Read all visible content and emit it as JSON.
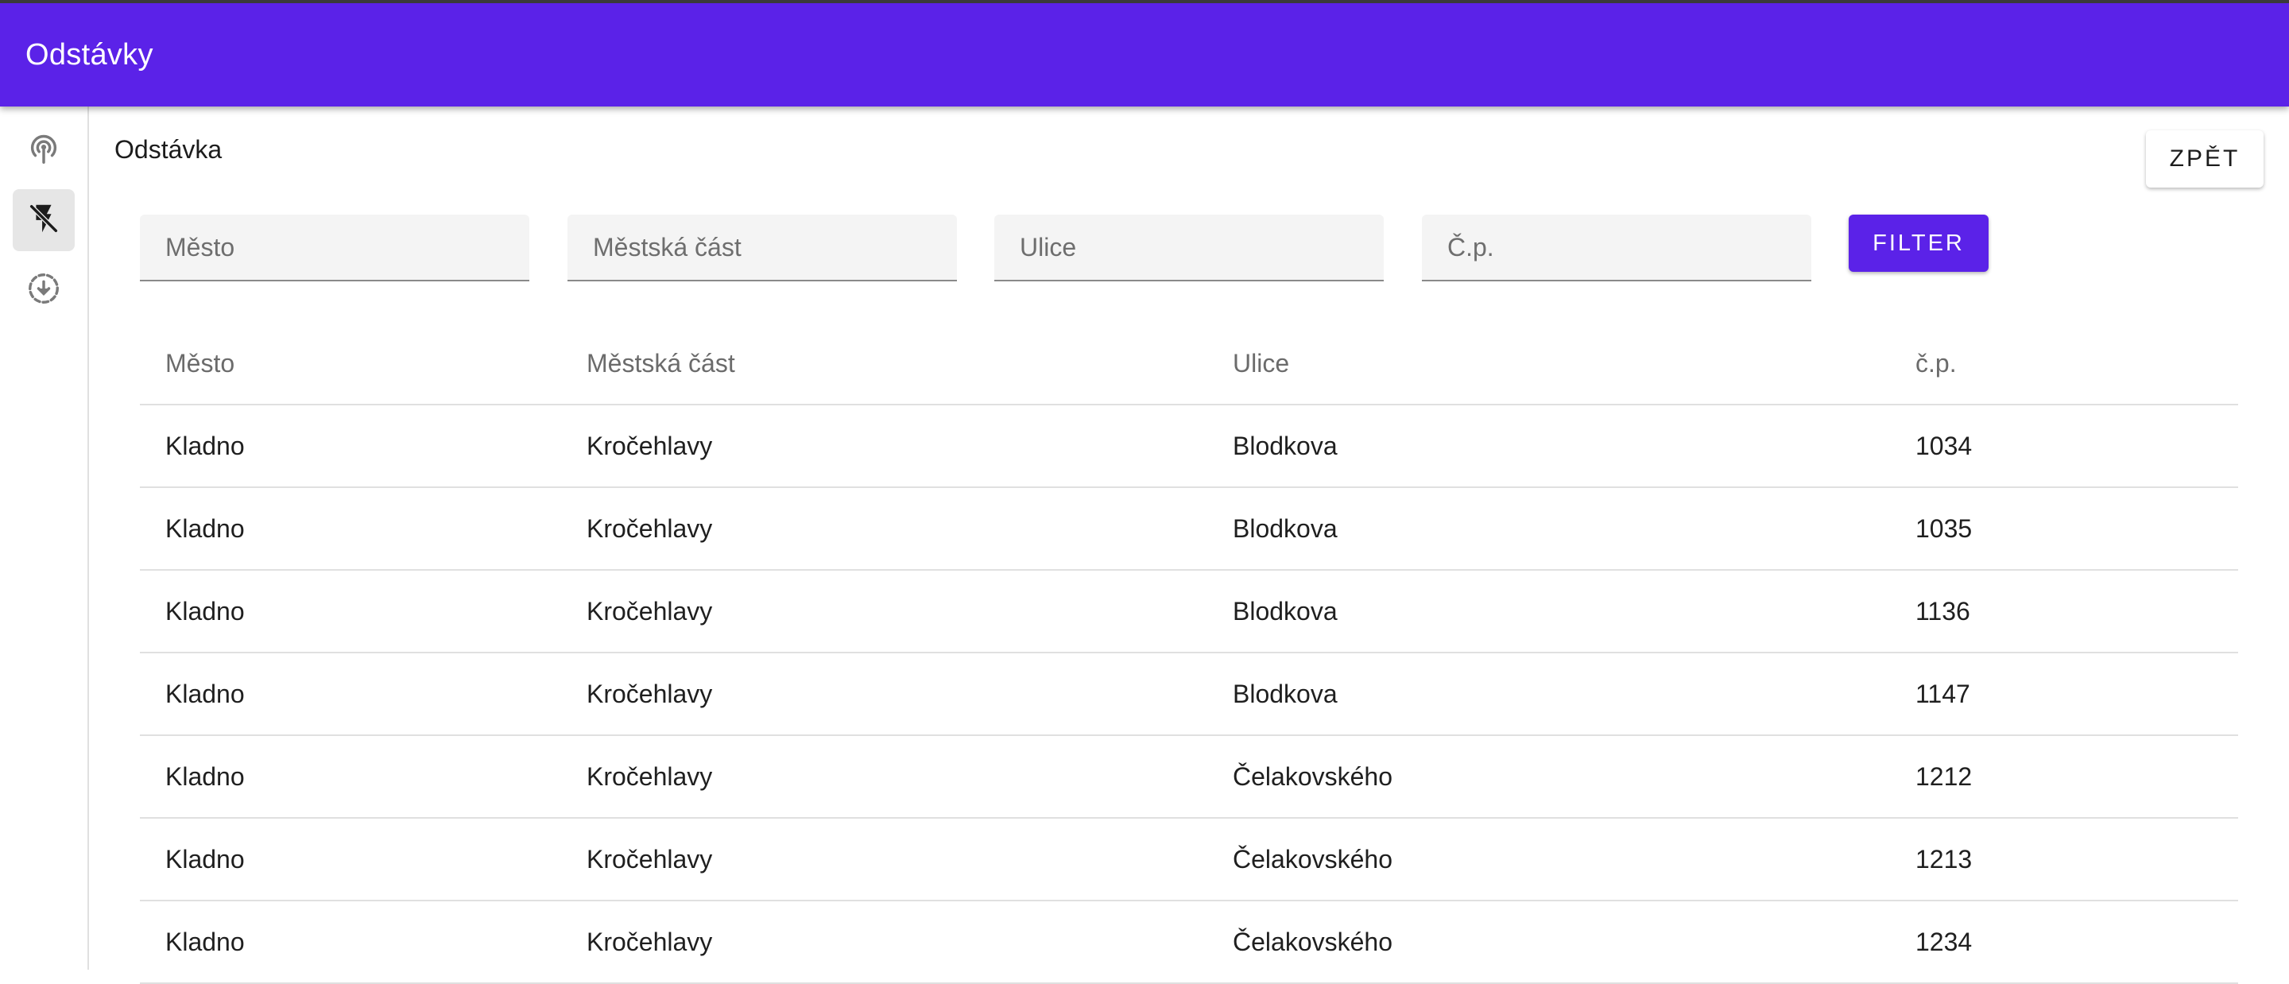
{
  "app": {
    "title": "Odstávky"
  },
  "rail": {
    "items": [
      {
        "icon": "antenna-icon",
        "active": false
      },
      {
        "icon": "flash-off-icon",
        "active": true
      },
      {
        "icon": "download-circle-icon",
        "active": false
      }
    ]
  },
  "page": {
    "section_title": "Odstávka",
    "back_label": "ZPĚT"
  },
  "filters": {
    "city_placeholder": "Město",
    "district_placeholder": "Městská část",
    "street_placeholder": "Ulice",
    "number_placeholder": "Č.p.",
    "city_value": "",
    "district_value": "",
    "street_value": "",
    "number_value": "",
    "filter_label": "FILTER"
  },
  "table": {
    "headers": [
      "Město",
      "Městská část",
      "Ulice",
      "č.p."
    ],
    "rows": [
      [
        "Kladno",
        "Kročehlavy",
        "Blodkova",
        "1034"
      ],
      [
        "Kladno",
        "Kročehlavy",
        "Blodkova",
        "1035"
      ],
      [
        "Kladno",
        "Kročehlavy",
        "Blodkova",
        "1136"
      ],
      [
        "Kladno",
        "Kročehlavy",
        "Blodkova",
        "1147"
      ],
      [
        "Kladno",
        "Kročehlavy",
        "Čelakovského",
        "1212"
      ],
      [
        "Kladno",
        "Kročehlavy",
        "Čelakovského",
        "1213"
      ],
      [
        "Kladno",
        "Kročehlavy",
        "Čelakovského",
        "1234"
      ]
    ]
  },
  "colors": {
    "primary": "#5b22e8",
    "rail_active": "#e6e6e6"
  }
}
